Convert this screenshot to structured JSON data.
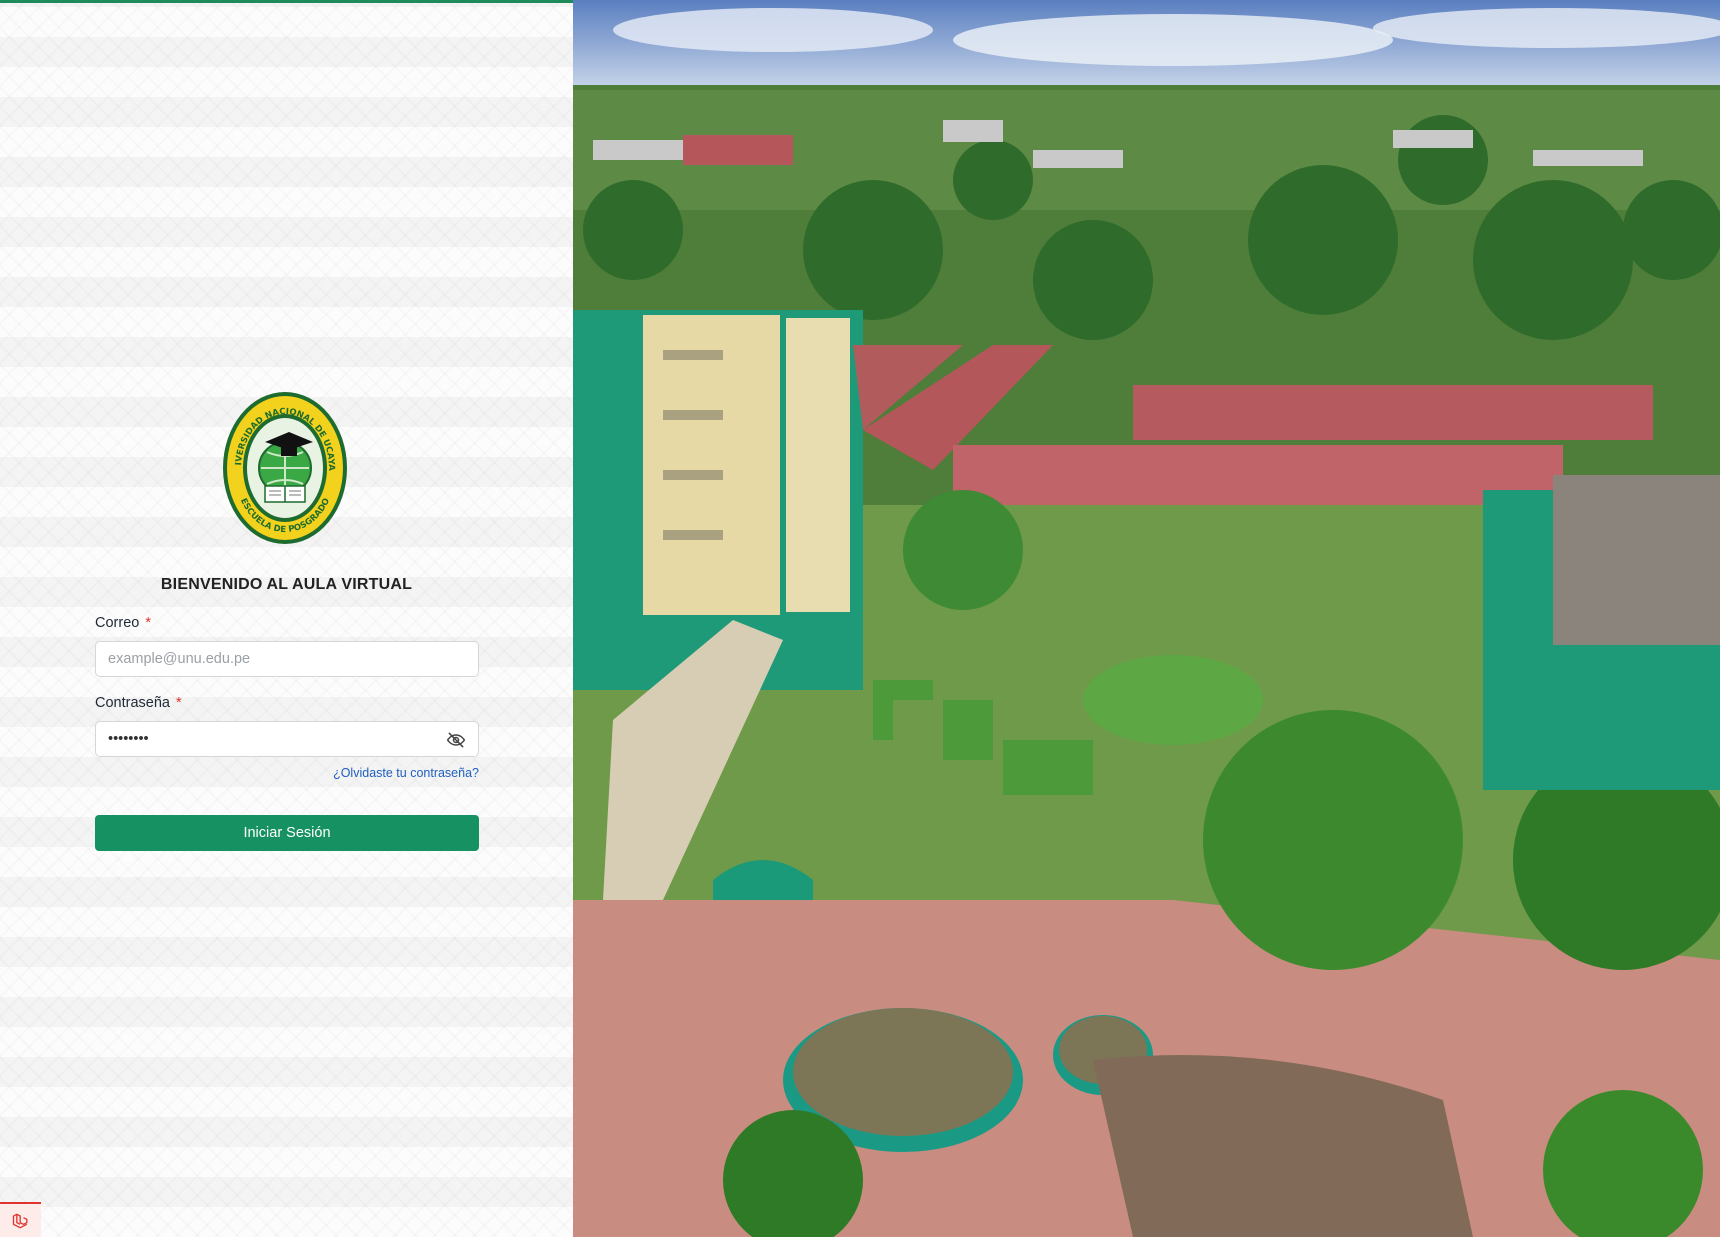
{
  "login": {
    "welcome_title": "BIENVENIDO AL AULA VIRTUAL",
    "email_label": "Correo",
    "email_required_mark": "*",
    "email_placeholder": "example@unu.edu.pe",
    "password_label": "Contraseña",
    "password_required_mark": "*",
    "password_value": "********",
    "forgot_link": "¿Olvidaste tu contraseña?",
    "submit_label": "Iniciar Sesión"
  },
  "logo": {
    "ring_text_top": "UNIVERSIDAD NACIONAL DE UCAYALI",
    "ring_text_bottom": "ESCUELA DE POSGRADO",
    "colors": {
      "ring": "#f2d21c",
      "border": "#1d6b2e",
      "inner": "#2f8a3a"
    }
  },
  "theme": {
    "accent": "#169262",
    "link": "#1f5fbf",
    "required": "#e0332f"
  },
  "icons": {
    "eye": "eye-off-icon",
    "corner": "laravel-icon"
  }
}
